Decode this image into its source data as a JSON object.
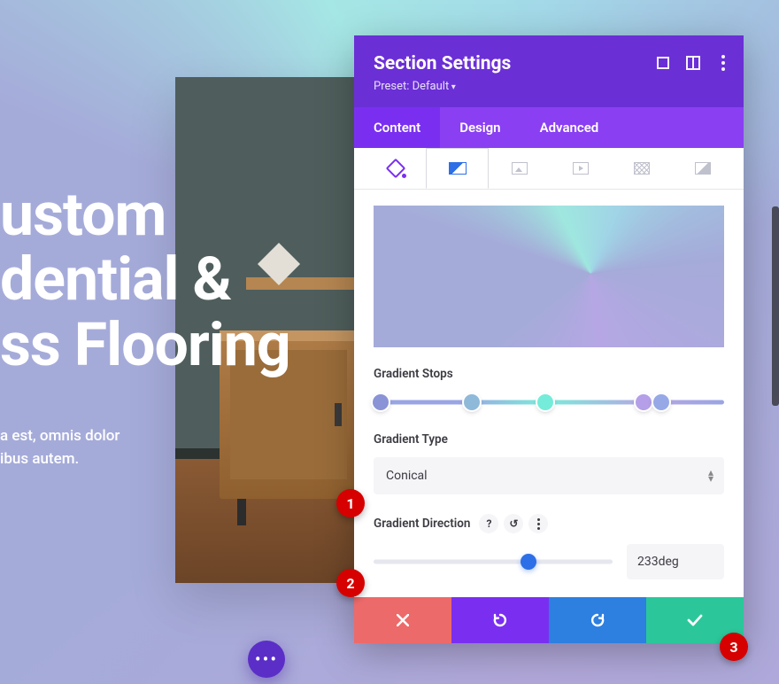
{
  "hero": {
    "line1": "ustom",
    "line2": "dential &",
    "line3": "ss Flooring",
    "sub1": "a est, omnis dolor",
    "sub2": "ibus autem."
  },
  "panel": {
    "title": "Section Settings",
    "preset": "Preset: Default",
    "tabs": {
      "content": "Content",
      "design": "Design",
      "advanced": "Advanced"
    },
    "labels": {
      "stops": "Gradient Stops",
      "type": "Gradient Type",
      "direction": "Gradient Direction"
    },
    "gradient": {
      "type_value": "Conical",
      "direction_value": "233deg",
      "direction_pct": 64.7,
      "stops": [
        {
          "pos": 2,
          "color": "#8a93d6"
        },
        {
          "pos": 28,
          "color": "#8fb9d9"
        },
        {
          "pos": 49,
          "color": "#74ecd9"
        },
        {
          "pos": 77,
          "color": "#b49fe8"
        },
        {
          "pos": 82,
          "color": "#97a8e6"
        }
      ]
    }
  },
  "badges": {
    "b1": "1",
    "b2": "2",
    "b3": "3"
  }
}
